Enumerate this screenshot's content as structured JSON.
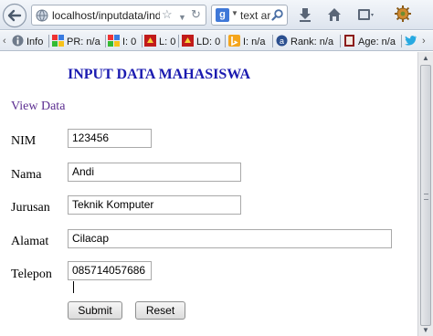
{
  "browser": {
    "url": "localhost/inputdata/ind",
    "search_text": "text ar",
    "search_engine_letter": "g"
  },
  "addon_toolbar": {
    "info_label": "Info",
    "pagerank_label": "PR: n/a",
    "indexed_label": "I: 0",
    "links_label": "L: 0",
    "linkdomains_label": "LD: 0",
    "index_label": "I: n/a",
    "rank_label": "Rank: n/a",
    "age_label": "Age: n/a"
  },
  "page": {
    "title": "INPUT DATA MAHASISWA",
    "view_link": "View Data",
    "form": {
      "nim_label": "NIM",
      "nim_value": "123456",
      "nama_label": "Nama",
      "nama_value": "Andi",
      "jurusan_label": "Jurusan",
      "jurusan_value": "Teknik Komputer",
      "alamat_label": "Alamat",
      "alamat_value": "Cilacap",
      "telepon_label": "Telepon",
      "telepon_value": "085714057686",
      "submit_label": "Submit",
      "reset_label": "Reset"
    }
  },
  "icons": {
    "back": "back-arrow-icon",
    "globe": "globe-icon",
    "bookmark": "star-icon",
    "reload": "reload-icon",
    "search": "magnifier-icon",
    "download": "download-icon",
    "home": "home-icon",
    "menu": "menu-icon",
    "addons": "gear-icon",
    "twitter": "twitter-icon"
  },
  "colors": {
    "title": "#1a1ab0",
    "link": "#5c2e91"
  }
}
